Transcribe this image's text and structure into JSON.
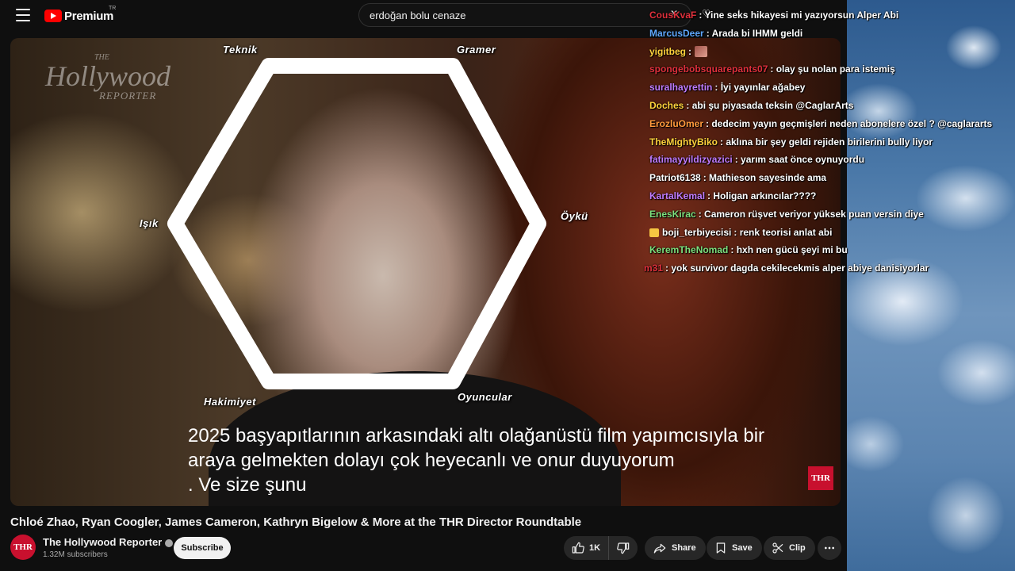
{
  "topbar": {
    "logo_text": "Premium",
    "logo_region": "TR",
    "search_value": "erdoğan bolu cenaze",
    "search_clear": "✕"
  },
  "player": {
    "watermark": {
      "line1": "THE",
      "line2": "Hollywood",
      "line3": "REPORTER"
    },
    "corner_badge": "THR",
    "hex_labels": {
      "top_left": "Teknik",
      "top_right": "Gramer",
      "left": "Işık",
      "right": "Öykü",
      "bottom_left": "Hakimiyet",
      "bottom_right": "Oyuncular"
    },
    "subtitle_lines": [
      "2025 başyapıtlarının arkasındaki altı olağanüstü film yapımcısıyla bir",
      "araya gelmekten dolayı çok heyecanlı ve onur duyuyorum",
      ".  Ve size şunu"
    ]
  },
  "video": {
    "title": "Chloé Zhao, Ryan Coogler, James Cameron, Kathryn Bigelow & More at the THR Director Roundtable",
    "channel_name": "The Hollywood Reporter",
    "channel_avatar": "THR",
    "subscribers": "1.32M subscribers",
    "subscribe_label": "Subscribe",
    "like_count": "1K",
    "share_label": "Share",
    "save_label": "Save",
    "clip_label": "Clip"
  },
  "chat": {
    "messages": [
      {
        "user": "CousKvaF",
        "color": "#e0303c",
        "text": ": Yine seks hikayesi mi yazıyorsun Alper Abi"
      },
      {
        "user": "MarcusDeer",
        "color": "#5fa8ff",
        "text": ": Arada bi IHMM geldi"
      },
      {
        "user": "yigitbeg",
        "color": "#ffd23c",
        "text": ":",
        "emote": true
      },
      {
        "user": "spongebobsquarepants07",
        "color": "#e0303c",
        "text": ": olay şu nolan para istemiş"
      },
      {
        "user": "suralhayrettin",
        "color": "#c07cff",
        "text": ": İyi yayınlar ağabey"
      },
      {
        "user": "Doches",
        "color": "#ffd23c",
        "text": ": abi şu piyasada teksin @CaglarArts"
      },
      {
        "user": "ErozluOmer",
        "color": "#ff9a3c",
        "text": ": dedecim yayın geçmişleri neden abonelere özel ? @caglararts"
      },
      {
        "user": "TheMightyBiko",
        "color": "#ffd23c",
        "text": ": aklına bir şey geldi rejiden birilerini bully liyor"
      },
      {
        "user": "fatimayyildizyazici",
        "color": "#c07cff",
        "text": ": yarım saat önce oynuyordu"
      },
      {
        "user": "Patriot6138",
        "color": "#ffffff",
        "text": ": Mathieson sayesinde ama"
      },
      {
        "user": "KartalKemal",
        "color": "#c07cff",
        "text": ": Holigan arkıncılar????"
      },
      {
        "user": "EnesKirac",
        "color": "#7de07d",
        "text": ": Cameron rüşvet veriyor yüksek puan versin diye"
      },
      {
        "user": "boji_terbiyecisi",
        "color": "#ffffff",
        "text": ": renk teorisi anlat abi",
        "crown": true
      },
      {
        "user": "KeremTheNomad",
        "color": "#7de07d",
        "text": ": hxh nen gücü şeyi mi bu"
      },
      {
        "user": "m31",
        "color": "#e0303c",
        "text": ": yok survivor dagda cekilecekmis alper abiye danisiyorlar"
      }
    ]
  }
}
